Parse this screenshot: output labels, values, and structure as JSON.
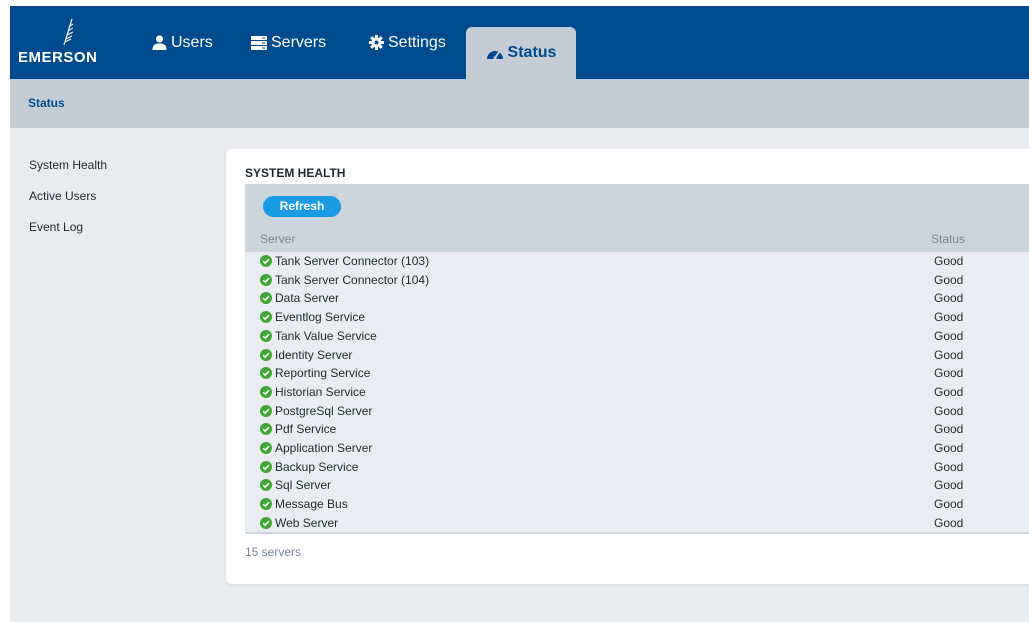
{
  "app": {
    "brand": "EMERSON",
    "nav": [
      {
        "label": "Users",
        "icon": "user-icon"
      },
      {
        "label": "Servers",
        "icon": "server-icon"
      },
      {
        "label": "Settings",
        "icon": "gear-icon"
      },
      {
        "label": "Status",
        "icon": "dashboard-icon",
        "active": true
      }
    ],
    "colors": {
      "topbar": "#004b8d",
      "accent": "#1a9be6",
      "ok": "#3fa535"
    }
  },
  "breadcrumb": {
    "label": "Status"
  },
  "sidebar": {
    "items": [
      {
        "label": "System Health"
      },
      {
        "label": "Active Users"
      },
      {
        "label": "Event Log"
      }
    ]
  },
  "panel": {
    "title": "SYSTEM HEALTH",
    "refresh_label": "Refresh",
    "columns": {
      "server": "Server",
      "status": "Status"
    },
    "rows": [
      {
        "server": "Tank Server Connector (103)",
        "status": "Good"
      },
      {
        "server": "Tank Server Connector (104)",
        "status": "Good"
      },
      {
        "server": "Data Server",
        "status": "Good"
      },
      {
        "server": "Eventlog Service",
        "status": "Good"
      },
      {
        "server": "Tank Value Service",
        "status": "Good"
      },
      {
        "server": "Identity Server",
        "status": "Good"
      },
      {
        "server": "Reporting Service",
        "status": "Good"
      },
      {
        "server": "Historian Service",
        "status": "Good"
      },
      {
        "server": "PostgreSql Server",
        "status": "Good"
      },
      {
        "server": "Pdf Service",
        "status": "Good"
      },
      {
        "server": "Application Server",
        "status": "Good"
      },
      {
        "server": "Backup Service",
        "status": "Good"
      },
      {
        "server": "Sql Server",
        "status": "Good"
      },
      {
        "server": "Message Bus",
        "status": "Good"
      },
      {
        "server": "Web Server",
        "status": "Good"
      }
    ],
    "count_label": "15 servers"
  }
}
